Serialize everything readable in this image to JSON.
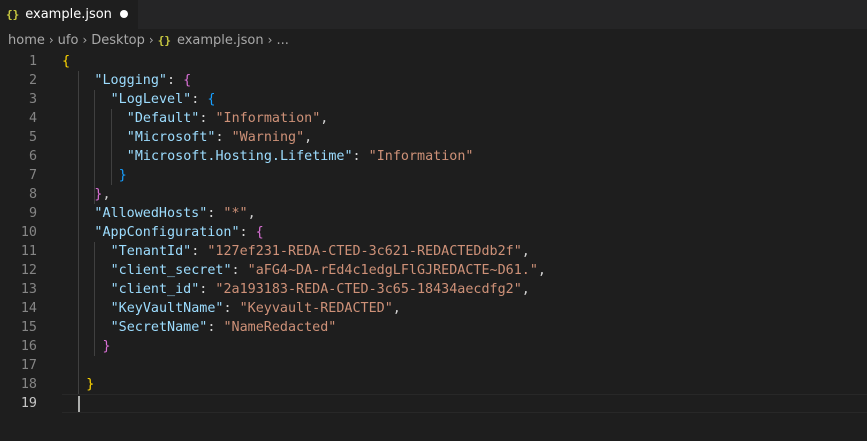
{
  "tab": {
    "filename": "example.json",
    "icon": "json-braces-icon",
    "modified": true,
    "icon_text": "{}"
  },
  "breadcrumb": {
    "segments": [
      "home",
      "ufo",
      "Desktop"
    ],
    "file_icon_text": "{}",
    "file": "example.json",
    "ellipsis": "..."
  },
  "editor": {
    "current_line": 19,
    "lines": [
      {
        "n": "1",
        "indent": 0,
        "tokens": [
          {
            "t": "{",
            "c": "b1"
          }
        ]
      },
      {
        "n": "2",
        "indent": 2,
        "tokens": [
          {
            "t": "\"Logging\"",
            "c": "k"
          },
          {
            "t": ": ",
            "c": "p"
          },
          {
            "t": "{",
            "c": "b2"
          }
        ]
      },
      {
        "n": "3",
        "indent": 3,
        "tokens": [
          {
            "t": "\"LogLevel\"",
            "c": "k"
          },
          {
            "t": ": ",
            "c": "p"
          },
          {
            "t": "{",
            "c": "b3"
          }
        ]
      },
      {
        "n": "4",
        "indent": 4,
        "tokens": [
          {
            "t": "\"Default\"",
            "c": "k"
          },
          {
            "t": ": ",
            "c": "p"
          },
          {
            "t": "\"Information\"",
            "c": "s"
          },
          {
            "t": ",",
            "c": "p"
          }
        ]
      },
      {
        "n": "5",
        "indent": 4,
        "tokens": [
          {
            "t": "\"Microsoft\"",
            "c": "k"
          },
          {
            "t": ": ",
            "c": "p"
          },
          {
            "t": "\"Warning\"",
            "c": "s"
          },
          {
            "t": ",",
            "c": "p"
          }
        ]
      },
      {
        "n": "6",
        "indent": 4,
        "tokens": [
          {
            "t": "\"Microsoft.Hosting.Lifetime\"",
            "c": "k"
          },
          {
            "t": ": ",
            "c": "p"
          },
          {
            "t": "\"Information\"",
            "c": "s"
          }
        ]
      },
      {
        "n": "7",
        "indent": 3.5,
        "tokens": [
          {
            "t": "}",
            "c": "b3"
          }
        ]
      },
      {
        "n": "8",
        "indent": 2,
        "tokens": [
          {
            "t": "}",
            "c": "b2"
          },
          {
            "t": ",",
            "c": "p"
          }
        ]
      },
      {
        "n": "9",
        "indent": 2,
        "tokens": [
          {
            "t": "\"AllowedHosts\"",
            "c": "k"
          },
          {
            "t": ": ",
            "c": "p"
          },
          {
            "t": "\"*\"",
            "c": "s"
          },
          {
            "t": ",",
            "c": "p"
          }
        ]
      },
      {
        "n": "10",
        "indent": 2,
        "tokens": [
          {
            "t": "\"AppConfiguration\"",
            "c": "k"
          },
          {
            "t": ": ",
            "c": "p"
          },
          {
            "t": "{",
            "c": "b2"
          }
        ]
      },
      {
        "n": "11",
        "indent": 3,
        "tokens": [
          {
            "t": "\"TenantId\"",
            "c": "k"
          },
          {
            "t": ": ",
            "c": "p"
          },
          {
            "t": "\"127ef231-REDA-CTED-3c621-REDACTEDdb2f\"",
            "c": "s"
          },
          {
            "t": ",",
            "c": "p"
          }
        ]
      },
      {
        "n": "12",
        "indent": 3,
        "tokens": [
          {
            "t": "\"client_secret\"",
            "c": "k"
          },
          {
            "t": ": ",
            "c": "p"
          },
          {
            "t": "\"aFG4~DA-rEd4c1edgLFlGJREDACTE~D61.\"",
            "c": "s"
          },
          {
            "t": ",",
            "c": "p"
          }
        ]
      },
      {
        "n": "13",
        "indent": 3,
        "tokens": [
          {
            "t": "\"client_id\"",
            "c": "k"
          },
          {
            "t": ": ",
            "c": "p"
          },
          {
            "t": "\"2a193183-REDA-CTED-3c65-18434aecdfg2\"",
            "c": "s"
          },
          {
            "t": ",",
            "c": "p"
          }
        ]
      },
      {
        "n": "14",
        "indent": 3,
        "tokens": [
          {
            "t": "\"KeyVaultName\"",
            "c": "k"
          },
          {
            "t": ": ",
            "c": "p"
          },
          {
            "t": "\"Keyvault-REDACTED\"",
            "c": "s"
          },
          {
            "t": ",",
            "c": "p"
          }
        ]
      },
      {
        "n": "15",
        "indent": 3,
        "tokens": [
          {
            "t": "\"SecretName\"",
            "c": "k"
          },
          {
            "t": ": ",
            "c": "p"
          },
          {
            "t": "\"NameRedacted\"",
            "c": "s"
          }
        ]
      },
      {
        "n": "16",
        "indent": 2.5,
        "tokens": [
          {
            "t": "}",
            "c": "b2"
          }
        ]
      },
      {
        "n": "17",
        "indent": 0,
        "tokens": []
      },
      {
        "n": "18",
        "indent": 1.5,
        "tokens": [
          {
            "t": "}",
            "c": "b1"
          }
        ]
      },
      {
        "n": "19",
        "indent": 0,
        "tokens": []
      }
    ]
  }
}
